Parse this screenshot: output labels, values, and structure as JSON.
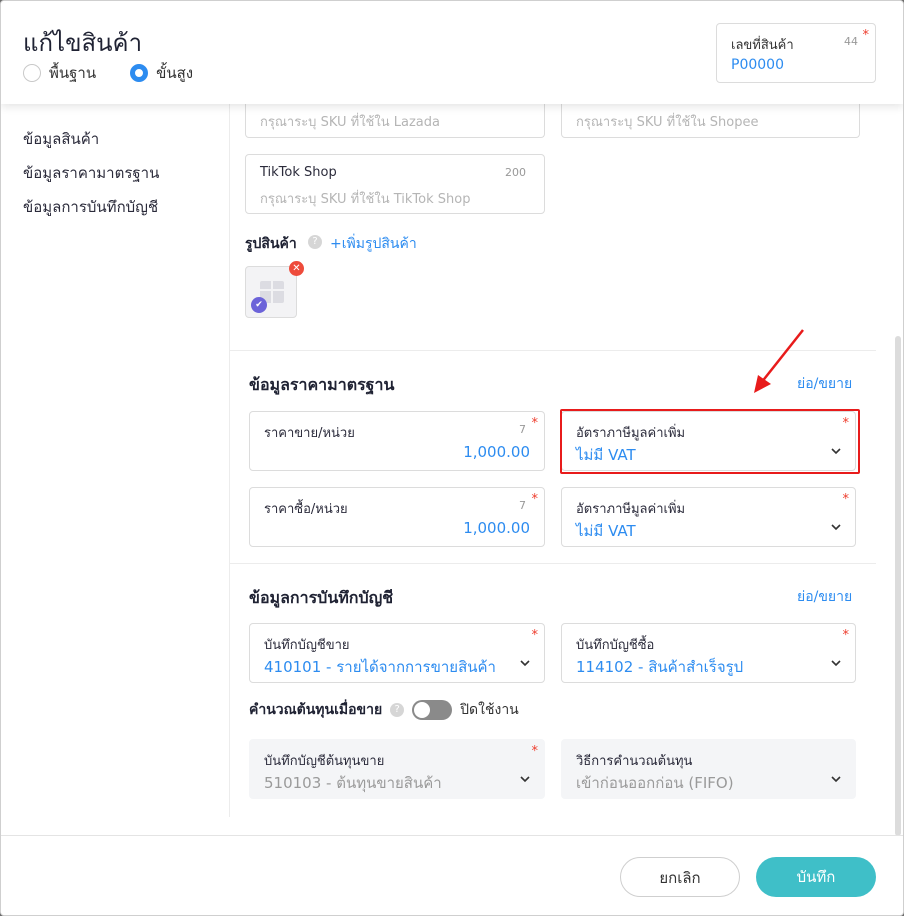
{
  "header": {
    "title": "แก้ไขสินค้า",
    "mode_options": [
      {
        "label": "พื้นฐาน",
        "selected": false
      },
      {
        "label": "ขั้นสูง",
        "selected": true
      }
    ],
    "sku": {
      "label": "เลขที่สินค้า",
      "count": "44",
      "value": "P00000"
    }
  },
  "sidebar": {
    "items": [
      "ข้อมูลสินค้า",
      "ข้อมูลราคามาตรฐาน",
      "ข้อมูลการบันทึกบัญชี"
    ]
  },
  "channels": {
    "lazada_placeholder": "กรุณาระบุ SKU ที่ใช้ใน Lazada",
    "shopee_placeholder": "กรุณาระบุ SKU ที่ใช้ใน Shopee",
    "tiktok": {
      "label": "TikTok Shop",
      "count": "200",
      "placeholder": "กรุณาระบุ SKU ที่ใช้ใน TikTok Shop"
    }
  },
  "product_image": {
    "label": "รูปสินค้า",
    "help": "?",
    "add_label": "+เพิ่มรูปสินค้า"
  },
  "pricing": {
    "title": "ข้อมูลราคามาตรฐาน",
    "toggle_label": "ย่อ/ขยาย",
    "sell_price": {
      "label": "ราคาขาย/หน่วย",
      "count": "7",
      "value": "1,000.00"
    },
    "sell_vat": {
      "label": "อัตราภาษีมูลค่าเพิ่ม",
      "value": "ไม่มี VAT"
    },
    "buy_price": {
      "label": "ราคาซื้อ/หน่วย",
      "count": "7",
      "value": "1,000.00"
    },
    "buy_vat": {
      "label": "อัตราภาษีมูลค่าเพิ่ม",
      "value": "ไม่มี VAT"
    }
  },
  "accounting": {
    "title": "ข้อมูลการบันทึกบัญชี",
    "toggle_label": "ย่อ/ขยาย",
    "sales_account": {
      "label": "บันทึกบัญชีขาย",
      "value": "410101 - รายได้จากการขายสินค้า"
    },
    "purchase_account": {
      "label": "บันทึกบัญชีซื้อ",
      "value": "114102 - สินค้าสำเร็จรูป"
    },
    "cost_calc": {
      "label": "คำนวณต้นทุนเมื่อขาย",
      "help": "?",
      "status": "ปิดใช้งาน",
      "enabled": false
    },
    "cogs_account": {
      "label": "บันทึกบัญชีต้นทุนขาย",
      "value": "510103 - ต้นทุนขายสินค้า"
    },
    "cost_method": {
      "label": "วิธีการคำนวณต้นทุน",
      "value": "เข้าก่อนออกก่อน (FIFO)"
    }
  },
  "footer": {
    "cancel_label": "ยกเลิก",
    "save_label": "บันทึก"
  },
  "colors": {
    "accent": "#2d8cf0",
    "save_button": "#3fbfc8",
    "highlight": "#e81b1b",
    "required": "#ee3b2b"
  }
}
